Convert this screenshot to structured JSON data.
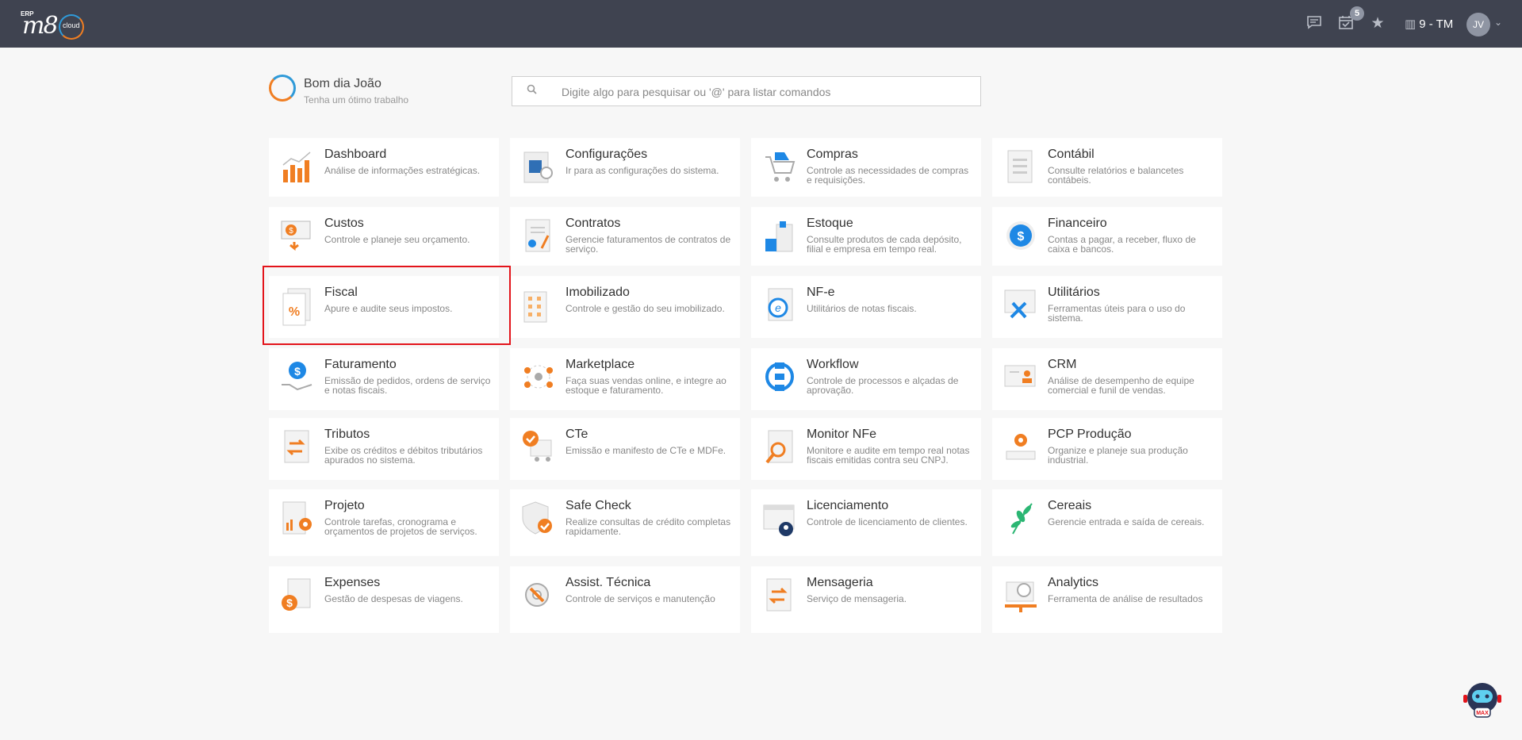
{
  "brand": {
    "erp": "ERP",
    "m8": "m8",
    "cloud": "cloud"
  },
  "topbar": {
    "icons": [
      "chat-icon",
      "calendar-icon",
      "star-icon"
    ],
    "notifications": "5",
    "company": "9 - TM",
    "user_initials": "JV"
  },
  "greeting": {
    "title": "Bom dia João",
    "subtitle": "Tenha um ótimo trabalho"
  },
  "search": {
    "placeholder": "Digite algo para pesquisar ou '@' para listar comandos"
  },
  "modules": [
    {
      "title": "Dashboard",
      "desc": "Análise de informações estratégicas.",
      "icon": "bar-chart-icon"
    },
    {
      "title": "Configurações",
      "desc": "Ir para as configurações do sistema.",
      "icon": "settings-icon"
    },
    {
      "title": "Compras",
      "desc": "Controle as necessidades de compras e requisições.",
      "icon": "cart-icon"
    },
    {
      "title": "Contábil",
      "desc": "Consulte relatórios e balancetes contábeis.",
      "icon": "ledger-icon"
    },
    {
      "title": "Custos",
      "desc": "Controle e planeje seu orçamento.",
      "icon": "coin-icon"
    },
    {
      "title": "Contratos",
      "desc": "Gerencie faturamentos de contratos de serviço.",
      "icon": "contract-icon"
    },
    {
      "title": "Estoque",
      "desc": "Consulte produtos de cada depósito, filial e empresa em tempo real.",
      "icon": "warehouse-icon"
    },
    {
      "title": "Financeiro",
      "desc": "Contas a pagar, a receber, fluxo de caixa e bancos.",
      "icon": "dollar-icon"
    },
    {
      "title": "Fiscal",
      "desc": "Apure e audite seus impostos.",
      "icon": "percent-document-icon"
    },
    {
      "title": "Imobilizado",
      "desc": "Controle e gestão do seu imobilizado.",
      "icon": "building-icon"
    },
    {
      "title": "NF-e",
      "desc": "Utilitários de notas fiscais.",
      "icon": "nfe-document-icon"
    },
    {
      "title": "Utilitários",
      "desc": "Ferramentas úteis para o uso do sistema.",
      "icon": "tools-icon"
    },
    {
      "title": "Faturamento",
      "desc": "Emissão de pedidos, ordens de serviço e notas fiscais.",
      "icon": "hand-dollar-icon"
    },
    {
      "title": "Marketplace",
      "desc": "Faça suas vendas online, e integre ao estoque e faturamento.",
      "icon": "network-icon"
    },
    {
      "title": "Workflow",
      "desc": "Controle de processos e alçadas de aprovação.",
      "icon": "workflow-icon"
    },
    {
      "title": "CRM",
      "desc": "Análise de desempenho de equipe comercial e funil de vendas.",
      "icon": "contact-card-icon"
    },
    {
      "title": "Tributos",
      "desc": "Exibe os créditos e débitos tributários apurados no sistema.",
      "icon": "exchange-document-icon"
    },
    {
      "title": "CTe",
      "desc": "Emissão e manifesto de CTe e MDFe.",
      "icon": "truck-icon"
    },
    {
      "title": "Monitor NFe",
      "desc": "Monitore e audite em tempo real notas fiscais emitidas contra seu CNPJ.",
      "icon": "magnifier-document-icon"
    },
    {
      "title": "PCP Produção",
      "desc": "Organize e planeje sua produção industrial.",
      "icon": "gear-production-icon"
    },
    {
      "title": "Projeto",
      "desc": "Controle tarefas, cronograma e orçamentos de projetos de serviços.",
      "icon": "project-icon"
    },
    {
      "title": "Safe Check",
      "desc": "Realize consultas de crédito completas rapidamente.",
      "icon": "shield-check-icon"
    },
    {
      "title": "Licenciamento",
      "desc": "Controle de licenciamento de clientes.",
      "icon": "license-icon"
    },
    {
      "title": "Cereais",
      "desc": "Gerencie entrada e saída de cereais.",
      "icon": "plant-icon"
    },
    {
      "title": "Expenses",
      "desc": "Gestão de despesas de viagens.",
      "icon": "expense-icon"
    },
    {
      "title": "Assist. Técnica",
      "desc": "Controle de serviços e manutenção",
      "icon": "wrench-gear-icon"
    },
    {
      "title": "Mensageria",
      "desc": "Serviço de mensageria.",
      "icon": "message-exchange-icon"
    },
    {
      "title": "Analytics",
      "desc": "Ferramenta de análise de resultados",
      "icon": "analytics-icon"
    }
  ],
  "assistant": {
    "label": "MAX"
  }
}
